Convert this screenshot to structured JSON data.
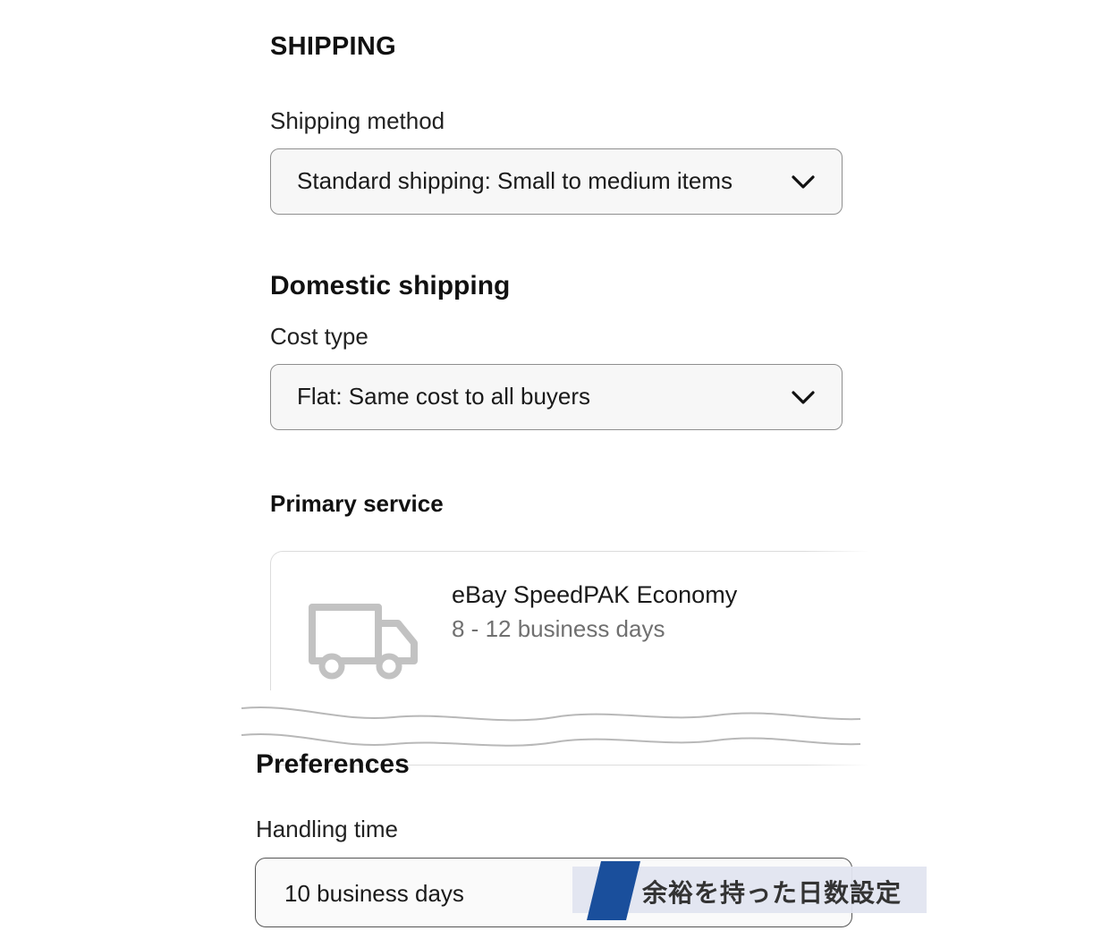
{
  "shipping": {
    "title": "SHIPPING",
    "method_label": "Shipping method",
    "method_value": "Standard shipping: Small to medium items",
    "domestic_title": "Domestic shipping",
    "cost_type_label": "Cost type",
    "cost_type_value": "Flat: Same cost to all buyers",
    "primary_service_title": "Primary service",
    "service": {
      "icon": "truck-icon",
      "name": "eBay SpeedPAK Economy",
      "days": "8 - 12 business days"
    }
  },
  "preferences": {
    "title": "Preferences",
    "handling_label": "Handling time",
    "handling_value": "10 business days"
  },
  "annotation": {
    "text": "余裕を持った日数設定",
    "accent": "#1a4f9c"
  }
}
